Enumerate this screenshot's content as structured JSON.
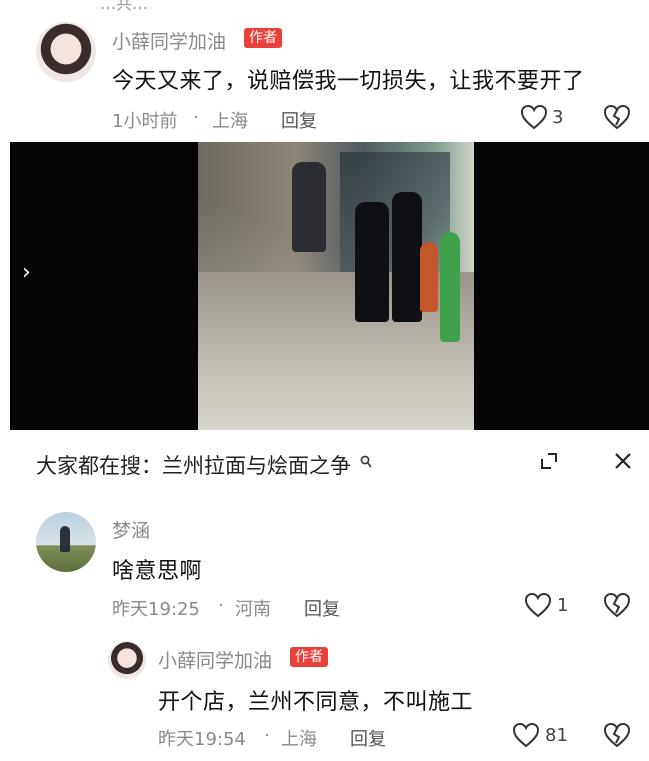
{
  "top_clip_text": "…共…",
  "comments": [
    {
      "author": "小薛同学加油",
      "tag": "作者",
      "content": "今天又来了，说赔偿我一切损失，让我不要开了",
      "time": "1小时前",
      "location": "上海",
      "reply": "回复",
      "likes": "3"
    },
    {
      "author": "梦涵",
      "content": "啥意思啊",
      "time": "昨天19:25",
      "location": "河南",
      "reply": "回复",
      "likes": "1"
    },
    {
      "author": "小薛同学加油",
      "tag": "作者",
      "content": "开个店，兰州不同意，不叫施工",
      "time": "昨天19:54",
      "location": "上海",
      "reply": "回复",
      "likes": "81"
    }
  ],
  "search_bar": {
    "text": "大家都在搜：兰州拉面与烩面之争"
  },
  "video": {
    "next_icon": "chevron-right-icon"
  },
  "separator": "·",
  "colors": {
    "author_tag": "#e8413b",
    "meta_text": "#8a8a8a"
  }
}
